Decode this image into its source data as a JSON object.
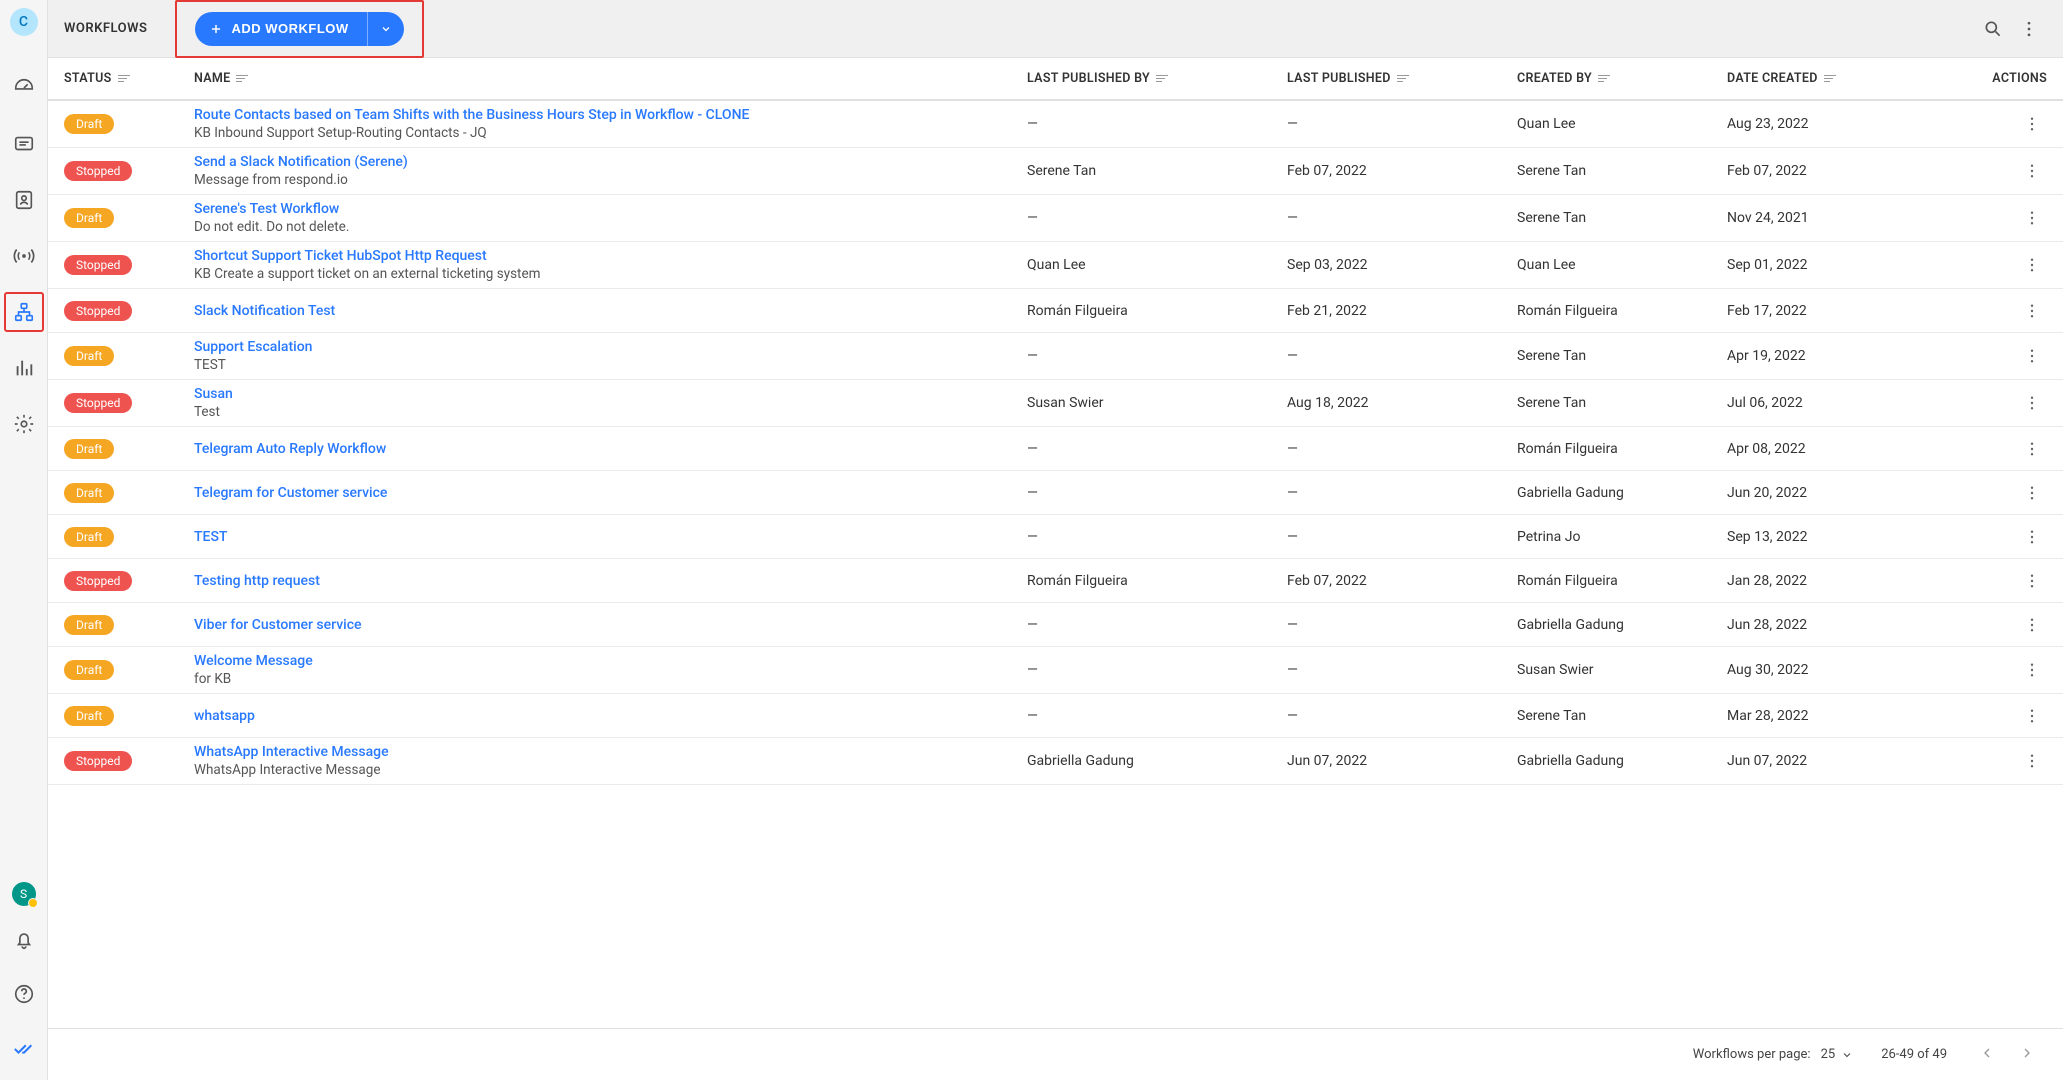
{
  "sidebar": {
    "avatar_top": "C",
    "avatar_bottom": "S"
  },
  "header": {
    "title": "WORKFLOWS",
    "add_button": "ADD WORKFLOW"
  },
  "columns": {
    "status": "STATUS",
    "name": "NAME",
    "last_published_by": "LAST PUBLISHED BY",
    "last_published": "LAST PUBLISHED",
    "created_by": "CREATED BY",
    "date_created": "DATE CREATED",
    "actions": "ACTIONS"
  },
  "status_labels": {
    "draft": "Draft",
    "stopped": "Stopped"
  },
  "rows": [
    {
      "status": "draft",
      "name": "Route Contacts based on Team Shifts with the Business Hours Step in Workflow - CLONE",
      "desc": "KB Inbound Support Setup-Routing Contacts - JQ",
      "lpb": "—",
      "lp": "—",
      "cb": "Quan Lee",
      "dc": "Aug 23, 2022"
    },
    {
      "status": "stopped",
      "name": "Send a Slack Notification (Serene)",
      "desc": "Message from respond.io",
      "lpb": "Serene Tan",
      "lp": "Feb 07, 2022",
      "cb": "Serene Tan",
      "dc": "Feb 07, 2022"
    },
    {
      "status": "draft",
      "name": "Serene's Test Workflow",
      "desc": "Do not edit. Do not delete.",
      "lpb": "—",
      "lp": "—",
      "cb": "Serene Tan",
      "dc": "Nov 24, 2021"
    },
    {
      "status": "stopped",
      "name": "Shortcut Support Ticket HubSpot Http Request",
      "desc": "KB Create a support ticket on an external ticketing system",
      "lpb": "Quan Lee",
      "lp": "Sep 03, 2022",
      "cb": "Quan Lee",
      "dc": "Sep 01, 2022"
    },
    {
      "status": "stopped",
      "name": "Slack Notification Test",
      "desc": "",
      "lpb": "Román Filgueira",
      "lp": "Feb 21, 2022",
      "cb": "Román Filgueira",
      "dc": "Feb 17, 2022"
    },
    {
      "status": "draft",
      "name": "Support Escalation",
      "desc": "TEST",
      "lpb": "—",
      "lp": "—",
      "cb": "Serene Tan",
      "dc": "Apr 19, 2022"
    },
    {
      "status": "stopped",
      "name": "Susan",
      "desc": "Test",
      "lpb": "Susan Swier",
      "lp": "Aug 18, 2022",
      "cb": "Serene Tan",
      "dc": "Jul 06, 2022"
    },
    {
      "status": "draft",
      "name": "Telegram Auto Reply Workflow",
      "desc": "",
      "lpb": "—",
      "lp": "—",
      "cb": "Román Filgueira",
      "dc": "Apr 08, 2022"
    },
    {
      "status": "draft",
      "name": "Telegram for Customer service",
      "desc": "",
      "lpb": "—",
      "lp": "—",
      "cb": "Gabriella Gadung",
      "dc": "Jun 20, 2022"
    },
    {
      "status": "draft",
      "name": "TEST",
      "desc": "",
      "lpb": "—",
      "lp": "—",
      "cb": "Petrina Jo",
      "dc": "Sep 13, 2022"
    },
    {
      "status": "stopped",
      "name": "Testing http request",
      "desc": "",
      "lpb": "Román Filgueira",
      "lp": "Feb 07, 2022",
      "cb": "Román Filgueira",
      "dc": "Jan 28, 2022"
    },
    {
      "status": "draft",
      "name": "Viber for Customer service",
      "desc": "",
      "lpb": "—",
      "lp": "—",
      "cb": "Gabriella Gadung",
      "dc": "Jun 28, 2022"
    },
    {
      "status": "draft",
      "name": "Welcome Message",
      "desc": "for KB",
      "lpb": "—",
      "lp": "—",
      "cb": "Susan Swier",
      "dc": "Aug 30, 2022"
    },
    {
      "status": "draft",
      "name": "whatsapp",
      "desc": "",
      "lpb": "—",
      "lp": "—",
      "cb": "Serene Tan",
      "dc": "Mar 28, 2022"
    },
    {
      "status": "stopped",
      "name": "WhatsApp Interactive Message",
      "desc": "WhatsApp Interactive Message",
      "lpb": "Gabriella Gadung",
      "lp": "Jun 07, 2022",
      "cb": "Gabriella Gadung",
      "dc": "Jun 07, 2022"
    }
  ],
  "pagination": {
    "per_page_label": "Workflows per page:",
    "per_page_value": "25",
    "range": "26-49 of 49"
  }
}
